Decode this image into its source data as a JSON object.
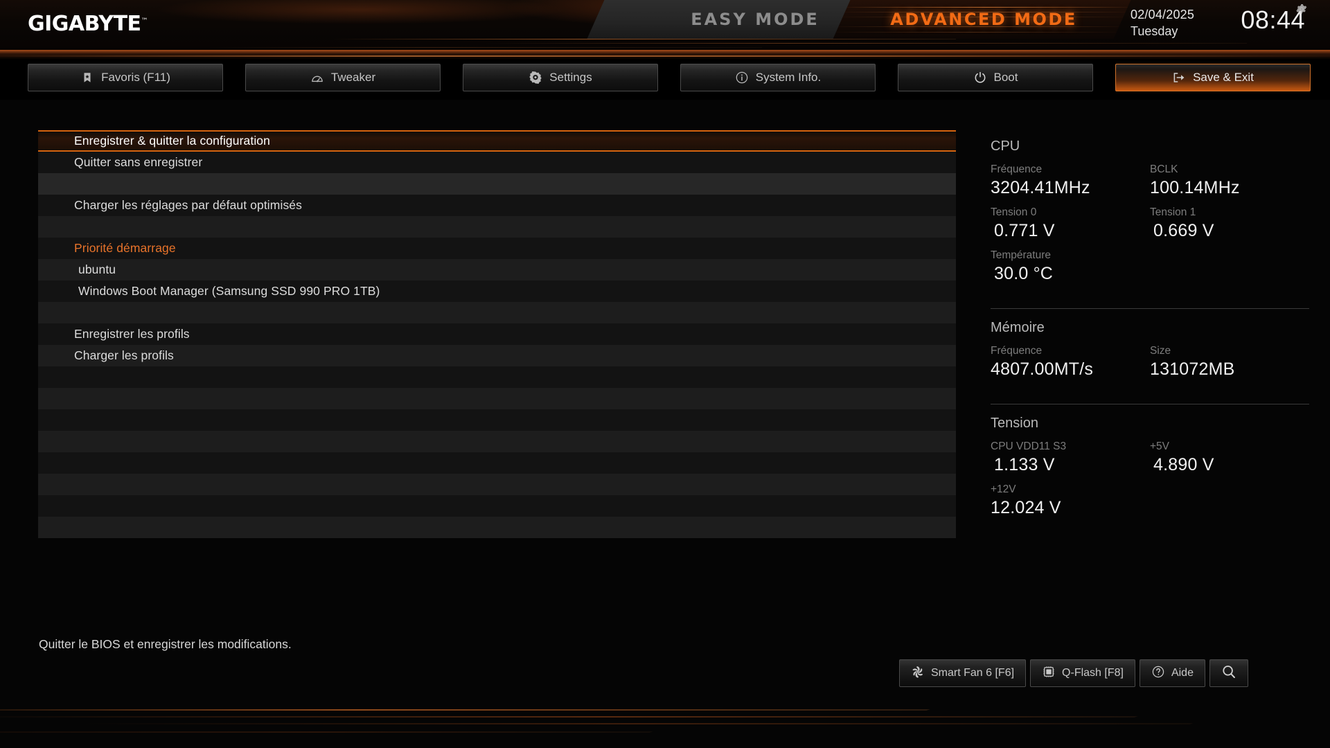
{
  "header": {
    "brand": "GIGABYTE",
    "brand_tm": "™",
    "mode_easy": "EASY MODE",
    "mode_advanced": "ADVANCED MODE",
    "date": "02/04/2025",
    "weekday": "Tuesday",
    "time": "08:44",
    "gear_icon": "gear-icon",
    "accent_color": "#f26b15"
  },
  "nav": {
    "tabs": [
      {
        "label": "Favoris (F11)",
        "icon": "bookmark-star-icon",
        "active": false
      },
      {
        "label": "Tweaker",
        "icon": "gauge-icon",
        "active": false
      },
      {
        "label": "Settings",
        "icon": "gear-icon",
        "active": false
      },
      {
        "label": "System Info.",
        "icon": "info-circle-icon",
        "active": false
      },
      {
        "label": "Boot",
        "icon": "power-icon",
        "active": false
      },
      {
        "label": "Save & Exit",
        "icon": "exit-arrow-icon",
        "active": true
      }
    ]
  },
  "menu": {
    "items": [
      {
        "label": "Enregistrer & quitter la configuration",
        "selected": true,
        "kind": "item"
      },
      {
        "label": "Quitter sans enregistrer",
        "selected": false,
        "kind": "item"
      },
      {
        "label": "",
        "selected": false,
        "kind": "gap"
      },
      {
        "label": "Charger les réglages par défaut optimisés",
        "selected": false,
        "kind": "item"
      },
      {
        "label": "",
        "selected": false,
        "kind": "gap"
      },
      {
        "label": "Priorité démarrage",
        "selected": false,
        "kind": "group"
      },
      {
        "label": "ubuntu",
        "selected": false,
        "kind": "sub"
      },
      {
        "label": "Windows Boot Manager (Samsung SSD 990 PRO 1TB)",
        "selected": false,
        "kind": "sub"
      },
      {
        "label": "",
        "selected": false,
        "kind": "gap"
      },
      {
        "label": "Enregistrer les profils",
        "selected": false,
        "kind": "item"
      },
      {
        "label": "Charger les profils",
        "selected": false,
        "kind": "item"
      },
      {
        "label": "",
        "selected": false,
        "kind": "gap"
      },
      {
        "label": "",
        "selected": false,
        "kind": "gap"
      },
      {
        "label": "",
        "selected": false,
        "kind": "gap"
      },
      {
        "label": "",
        "selected": false,
        "kind": "gap"
      },
      {
        "label": "",
        "selected": false,
        "kind": "gap"
      },
      {
        "label": "",
        "selected": false,
        "kind": "gap"
      },
      {
        "label": "",
        "selected": false,
        "kind": "gap"
      },
      {
        "label": "",
        "selected": false,
        "kind": "gap"
      }
    ]
  },
  "sidebar": {
    "cpu": {
      "title": "CPU",
      "frequency_label": "Fréquence",
      "frequency_value": "3204.41MHz",
      "bclk_label": "BCLK",
      "bclk_value": "100.14MHz",
      "voltage0_label": "Tension 0",
      "voltage0_value": "0.771 V",
      "voltage1_label": "Tension 1",
      "voltage1_value": "0.669 V",
      "temp_label": "Température",
      "temp_value": "30.0 °C"
    },
    "memory": {
      "title": "Mémoire",
      "frequency_label": "Fréquence",
      "frequency_value": "4807.00MT/s",
      "size_label": "Size",
      "size_value": "131072MB"
    },
    "voltage": {
      "title": "Tension",
      "vdd11_label": "CPU VDD11 S3",
      "vdd11_value": "1.133 V",
      "v5_label": "+5V",
      "v5_value": "4.890 V",
      "v12_label": "+12V",
      "v12_value": "12.024 V"
    }
  },
  "footer": {
    "status": "Quitter le BIOS et enregistrer les modifications.",
    "buttons": [
      {
        "label": "Smart Fan 6 [F6]",
        "icon": "fan-icon"
      },
      {
        "label": "Q-Flash [F8]",
        "icon": "chip-icon"
      },
      {
        "label": "Aide",
        "icon": "question-circle-icon"
      },
      {
        "label": "",
        "icon": "search-icon"
      }
    ]
  }
}
